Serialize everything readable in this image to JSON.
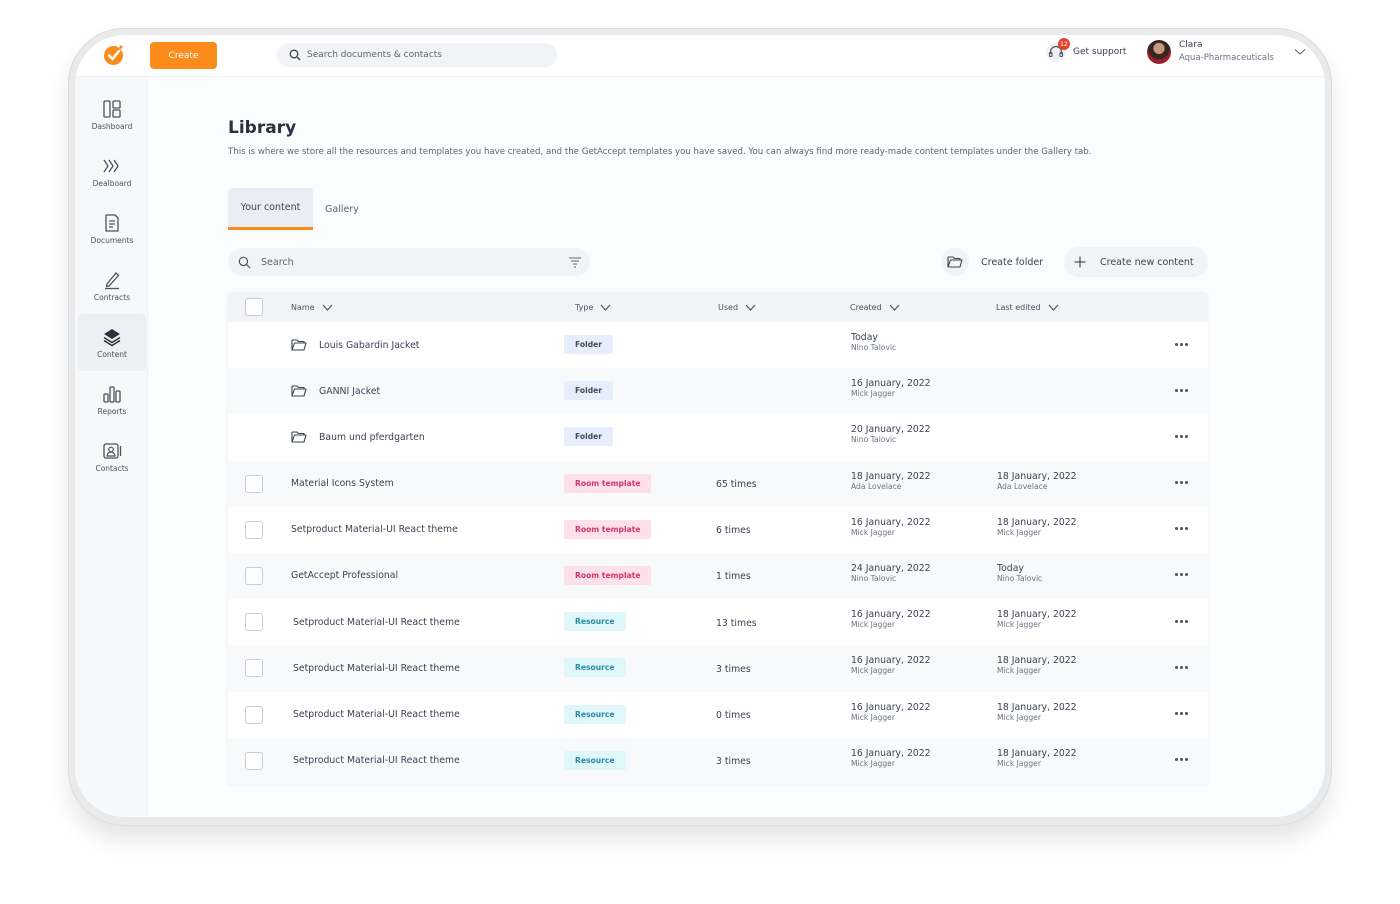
{
  "app": {
    "create_label": "Create",
    "search_placeholder": "Search documents & contacts",
    "support_label": "Get support",
    "support_badge": "12",
    "user_name": "Clara",
    "user_org": "Aqua-Pharmaceuticals",
    "brand_color": "#fb8c1c"
  },
  "sidebar": {
    "items": [
      {
        "label": "Dashboard",
        "icon": "dashboard-icon"
      },
      {
        "label": "Dealboard",
        "icon": "chevrons-right-icon"
      },
      {
        "label": "Documents",
        "icon": "document-icon"
      },
      {
        "label": "Contracts",
        "icon": "pen-icon"
      },
      {
        "label": "Content",
        "icon": "layers-icon",
        "active": true
      },
      {
        "label": "Reports",
        "icon": "bar-chart-icon"
      },
      {
        "label": "Contacts",
        "icon": "contact-card-icon"
      }
    ]
  },
  "library": {
    "title": "Library",
    "description": "This is where we store all the resources and templates you have created, and the GetAccept templates you have saved. You can always find more ready-made content templates under the Gallery tab.",
    "tabs": [
      {
        "label": "Your content",
        "active": true
      },
      {
        "label": "Gallery",
        "active": false
      }
    ],
    "search_placeholder": "Search",
    "create_folder_label": "Create folder",
    "create_content_label": "Create new content"
  },
  "table": {
    "columns": [
      "Name",
      "Type",
      "Used",
      "Created",
      "Last edited"
    ],
    "rows": [
      {
        "kind": "folder",
        "name": "Louis Gabardin Jacket",
        "type": "Folder",
        "used": "",
        "created": "Today",
        "created_by": "Nino Talovic",
        "edited": "",
        "edited_by": ""
      },
      {
        "kind": "folder",
        "name": "GANNI Jacket",
        "type": "Folder",
        "used": "",
        "created": "16 January, 2022",
        "created_by": "Mick Jagger",
        "edited": "",
        "edited_by": ""
      },
      {
        "kind": "folder",
        "name": "Baum und pferdgarten",
        "type": "Folder",
        "used": "",
        "created": "20 January, 2022",
        "created_by": "Nino Talovic",
        "edited": "",
        "edited_by": ""
      },
      {
        "kind": "room",
        "name": "Material Icons System",
        "type": "Room template",
        "used": "65 times",
        "created": "18 January, 2022",
        "created_by": "Ada Lovelace",
        "edited": "18 January, 2022",
        "edited_by": "Ada Lovelace"
      },
      {
        "kind": "room",
        "name": "Setproduct Material-UI React theme",
        "type": "Room template",
        "used": "6 times",
        "created": "16 January, 2022",
        "created_by": "Mick Jagger",
        "edited": "18 January, 2022",
        "edited_by": "Mick Jagger"
      },
      {
        "kind": "room",
        "name": "GetAccept Professional",
        "type": "Room template",
        "used": "1 times",
        "created": "24 January, 2022",
        "created_by": "Nino Talovic",
        "edited": "Today",
        "edited_by": "Nino Talovic"
      },
      {
        "kind": "resource",
        "name": "Setproduct Material-UI React theme",
        "type": "Resource",
        "used": "13 times",
        "created": "16 January, 2022",
        "created_by": "Mick Jagger",
        "edited": "18 January, 2022",
        "edited_by": "Mick Jagger"
      },
      {
        "kind": "resource",
        "name": "Setproduct Material-UI React theme",
        "type": "Resource",
        "used": "3 times",
        "created": "16 January, 2022",
        "created_by": "Mick Jagger",
        "edited": "18 January, 2022",
        "edited_by": "Mick Jagger"
      },
      {
        "kind": "resource",
        "name": "Setproduct Material-UI React theme",
        "type": "Resource",
        "used": "0 times",
        "created": "16 January, 2022",
        "created_by": "Mick Jagger",
        "edited": "18 January, 2022",
        "edited_by": "Mick Jagger"
      },
      {
        "kind": "resource",
        "name": "Setproduct Material-UI React theme",
        "type": "Resource",
        "used": "3 times",
        "created": "16 January, 2022",
        "created_by": "Mick Jagger",
        "edited": "18 January, 2022",
        "edited_by": "Mick Jagger"
      }
    ]
  }
}
